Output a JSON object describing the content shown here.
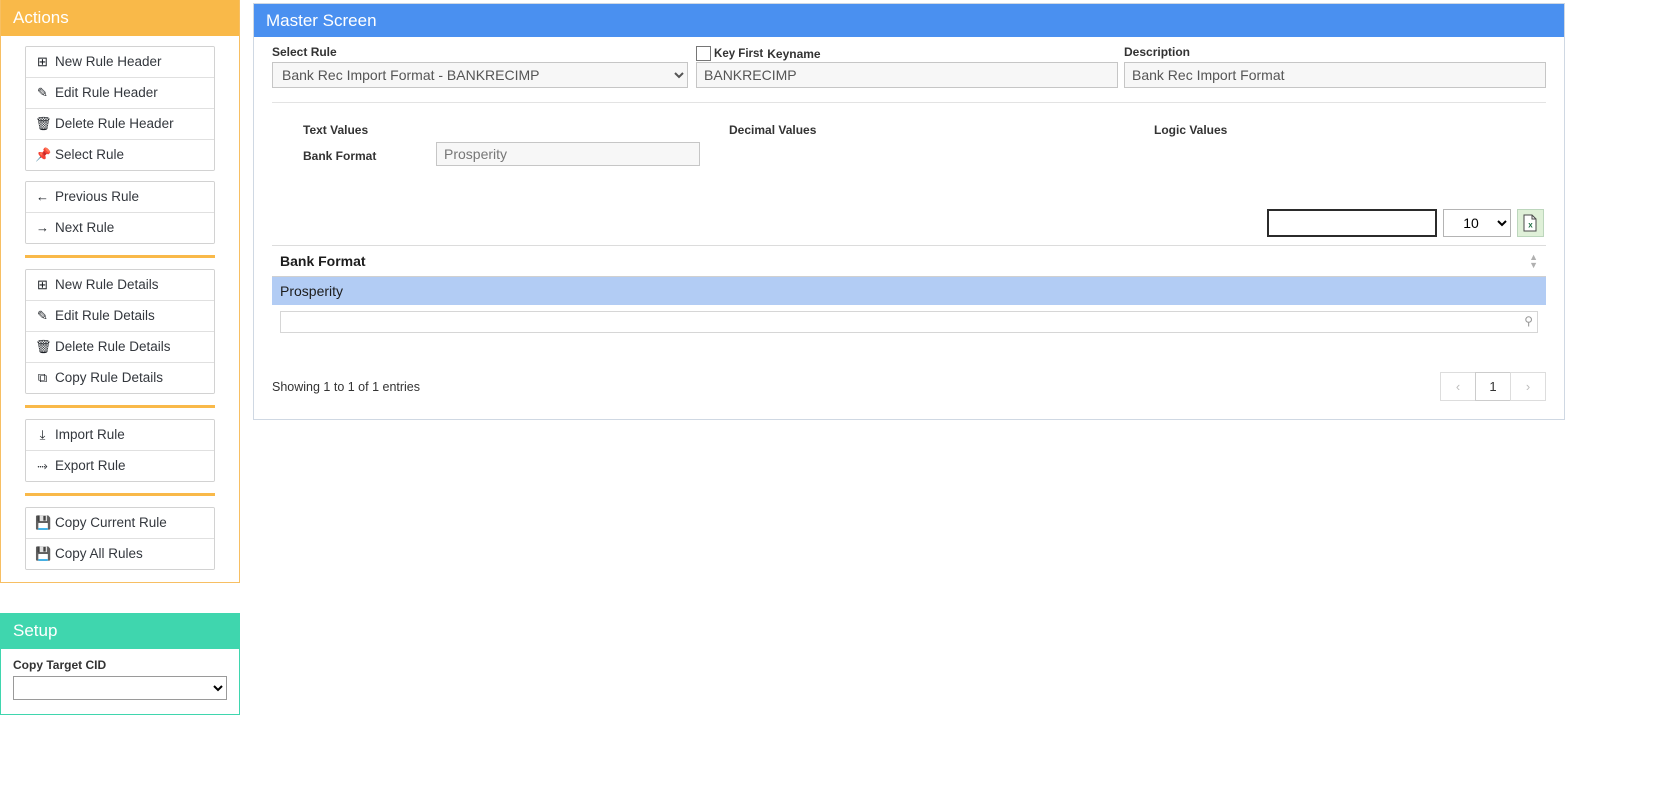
{
  "sidebar": {
    "actions_title": "Actions",
    "groups": [
      {
        "items": [
          {
            "icon": "plus-square-icon",
            "glyph": "⊞",
            "label": "New Rule Header"
          },
          {
            "icon": "pencil-icon",
            "glyph": "✎",
            "label": "Edit Rule Header"
          },
          {
            "icon": "trash-icon",
            "glyph": "🗑",
            "label": "Delete Rule Header"
          },
          {
            "icon": "pin-icon",
            "glyph": "📌",
            "label": "Select Rule"
          }
        ]
      },
      {
        "items": [
          {
            "icon": "arrow-left-icon",
            "glyph": "←",
            "label": "Previous Rule"
          },
          {
            "icon": "arrow-right-icon",
            "glyph": "→",
            "label": "Next Rule"
          }
        ]
      },
      {
        "items": [
          {
            "icon": "plus-square-icon",
            "glyph": "⊞",
            "label": "New Rule Details"
          },
          {
            "icon": "pencil-icon",
            "glyph": "✎",
            "label": "Edit Rule Details"
          },
          {
            "icon": "trash-icon",
            "glyph": "🗑",
            "label": "Delete Rule Details"
          },
          {
            "icon": "copy-icon",
            "glyph": "⧉",
            "label": "Copy Rule Details"
          }
        ]
      },
      {
        "items": [
          {
            "icon": "download-icon",
            "glyph": "⤓",
            "label": "Import Rule"
          },
          {
            "icon": "upload-icon",
            "glyph": "⤑",
            "label": "Export Rule"
          }
        ]
      },
      {
        "items": [
          {
            "icon": "save-icon",
            "glyph": "💾",
            "label": "Copy Current Rule"
          },
          {
            "icon": "save-icon",
            "glyph": "💾",
            "label": "Copy All Rules"
          }
        ]
      }
    ],
    "setup_title": "Setup",
    "setup_field_label": "Copy Target CID",
    "setup_field_value": ""
  },
  "main": {
    "title": "Master Screen",
    "select_rule": {
      "label": "Select Rule",
      "value": "Bank Rec Import Format - BANKRECIMP"
    },
    "key_first": {
      "label": "Key First",
      "checked": false
    },
    "keyname": {
      "label": "Keyname",
      "value": "BANKRECIMP"
    },
    "description": {
      "label": "Description",
      "value": "Bank Rec Import Format"
    },
    "value_columns": {
      "text": "Text Values",
      "decimal": "Decimal Values",
      "logic": "Logic Values"
    },
    "bank_format_field": {
      "label": "Bank Format",
      "value": "Prosperity"
    },
    "toolbar": {
      "search_value": "",
      "search_placeholder": "",
      "page_length": "10",
      "excel_icon": "excel-export-icon",
      "excel_glyph": "x"
    },
    "table": {
      "columns": [
        "Bank Format"
      ],
      "rows": [
        {
          "cells": [
            "Prosperity"
          ],
          "selected": true
        }
      ],
      "filter_values": [
        ""
      ],
      "filter_icon": "magnifier-icon",
      "sort_icon": "sort-icon"
    },
    "footer": {
      "showing": "Showing 1 to 1 of 1 entries",
      "pagination": {
        "prev": "‹",
        "pages": [
          "1"
        ],
        "next": "›",
        "current": "1"
      }
    }
  },
  "colors": {
    "actions_header": "#f9b949",
    "setup_header": "#3fd6ae",
    "main_header": "#4a90f0",
    "row_selected": "#b2ccf4",
    "excel_button": "#dff0d8"
  }
}
